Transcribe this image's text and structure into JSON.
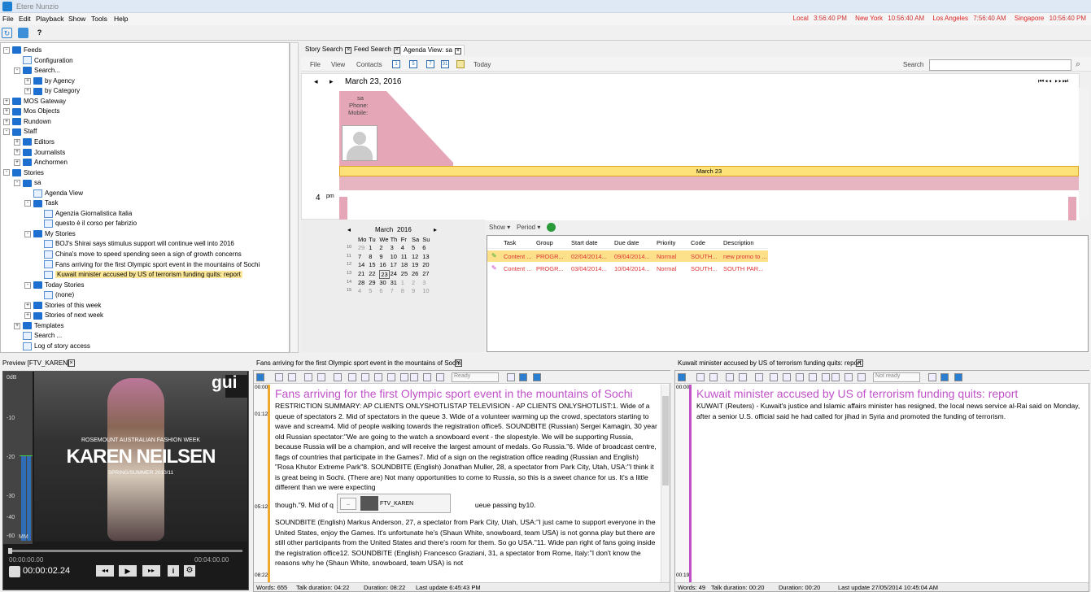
{
  "app": {
    "title": "Etere Nunzio"
  },
  "menu": [
    "File",
    "Edit",
    "Playback",
    "Show",
    "Tools",
    "Help"
  ],
  "clocks": [
    {
      "city": "Local",
      "time": "3:56:40 PM"
    },
    {
      "city": "New York",
      "time": "10:56:40 AM"
    },
    {
      "city": "Los Angeles",
      "time": "7:56:40 AM"
    },
    {
      "city": "Singapore",
      "time": "10:56:40 PM"
    }
  ],
  "tree": [
    {
      "label": "Feeds",
      "level": 0,
      "ex": "-"
    },
    {
      "label": "Configuration",
      "level": 1
    },
    {
      "label": "Search...",
      "level": 1,
      "ex": "-"
    },
    {
      "label": "by Agency",
      "level": 2,
      "ex": "+"
    },
    {
      "label": "by Category",
      "level": 2,
      "ex": "+"
    },
    {
      "label": "MOS Gateway",
      "level": 0,
      "ex": "+"
    },
    {
      "label": "Mos Objects",
      "level": 0,
      "ex": "+"
    },
    {
      "label": "Rundown",
      "level": 0,
      "ex": "+"
    },
    {
      "label": "Staff",
      "level": 0,
      "ex": "-"
    },
    {
      "label": "Editors",
      "level": 1,
      "ex": "+"
    },
    {
      "label": "Journalists",
      "level": 1,
      "ex": "+"
    },
    {
      "label": "Anchormen",
      "level": 1,
      "ex": "+"
    },
    {
      "label": "Stories",
      "level": 0,
      "ex": "-"
    },
    {
      "label": "sa",
      "level": 1,
      "ex": "-"
    },
    {
      "label": "Agenda View",
      "level": 2
    },
    {
      "label": "Task",
      "level": 2,
      "ex": "-"
    },
    {
      "label": "Agenzia Giornalistica Italia",
      "level": 3
    },
    {
      "label": "questo è il corso per fabrizio",
      "level": 3
    },
    {
      "label": "My Stories",
      "level": 2,
      "ex": "-"
    },
    {
      "label": "BOJ's Shirai says stimulus support will continue well into 2016",
      "level": 3
    },
    {
      "label": "China's move to speed spending seen a sign of growth concerns",
      "level": 3
    },
    {
      "label": "Fans arriving for the first Olympic sport event in the mountains of Sochi",
      "level": 3
    },
    {
      "label": "Kuwait minister accused by US of terrorism funding quits: report",
      "level": 3,
      "sel": true
    },
    {
      "label": "Today Stories",
      "level": 2,
      "ex": "-"
    },
    {
      "label": "(none)",
      "level": 3
    },
    {
      "label": "Stories of this week",
      "level": 2,
      "ex": "+"
    },
    {
      "label": "Stories of next week",
      "level": 2,
      "ex": "+"
    },
    {
      "label": "Templates",
      "level": 1,
      "ex": "+"
    },
    {
      "label": "Search ...",
      "level": 1
    },
    {
      "label": "Log of story access",
      "level": 1
    }
  ],
  "tabs": [
    "Story Search",
    "Feed Search",
    "Agenda View: sa"
  ],
  "agenda_toolbar": {
    "file": "File",
    "view": "View",
    "contacts": "Contacts",
    "today": "Today",
    "search_label": "Search",
    "cal_icons": [
      "1",
      "5",
      "7",
      "31"
    ]
  },
  "agenda": {
    "date": "March 23, 2016",
    "person": "sa",
    "phone": "Phone:",
    "mobile": "Mobile:",
    "day_label": "March 23",
    "hour": "4",
    "ampm": "pm"
  },
  "minical": {
    "month": "March",
    "year": "2016",
    "days": [
      "Mo",
      "Tu",
      "We",
      "Th",
      "Fr",
      "Sa",
      "Su"
    ],
    "weeks": [
      {
        "wk": "10",
        "d": [
          "29",
          "1",
          "2",
          "3",
          "4",
          "5",
          "6"
        ]
      },
      {
        "wk": "11",
        "d": [
          "7",
          "8",
          "9",
          "10",
          "11",
          "12",
          "13"
        ]
      },
      {
        "wk": "12",
        "d": [
          "14",
          "15",
          "16",
          "17",
          "18",
          "19",
          "20"
        ]
      },
      {
        "wk": "13",
        "d": [
          "21",
          "22",
          "23",
          "24",
          "25",
          "26",
          "27"
        ]
      },
      {
        "wk": "14",
        "d": [
          "28",
          "29",
          "30",
          "31",
          "1",
          "2",
          "3"
        ]
      },
      {
        "wk": "15",
        "d": [
          "4",
          "5",
          "6",
          "7",
          "8",
          "9",
          "10"
        ]
      }
    ]
  },
  "tasks": {
    "show": "Show",
    "period": "Period",
    "columns": [
      "Task",
      "Group",
      "Start date",
      "Due date",
      "Priority",
      "Code",
      "Description"
    ],
    "rows": [
      {
        "task": "Content ...",
        "group": "PROGR...",
        "start": "02/04/2014...",
        "due": "09/04/2014...",
        "priority": "Normal",
        "code": "SOUTH...",
        "desc": "new promo to ..."
      },
      {
        "task": "Content ...",
        "group": "PROGR...",
        "start": "03/04/2014...",
        "due": "10/04/2014...",
        "priority": "Normal",
        "code": "SOUTH...",
        "desc": "SOUTH PAR..."
      }
    ]
  },
  "preview": {
    "header": "Preview [FTV_KAREN]",
    "db": [
      "0dB",
      "-10",
      "-20",
      "-30",
      "-40",
      "-60"
    ],
    "mm": "MM",
    "event": "ROSEMOUNT AUSTRALIAN FASHION WEEK",
    "name": "KAREN NEILSEN",
    "season": "SPRING/SUMMER 2010/11",
    "logo": "gui",
    "tc_start": "00:00:00.00",
    "tc_end": "00:04:00.00",
    "tc_current": "00:00:02.24"
  },
  "editor1": {
    "header": "Fans arriving for the first Olympic sport event in the mountains of Sochi",
    "status_select": "Ready",
    "gutter": [
      "00:00",
      "01:12",
      "05:12",
      "08:22"
    ],
    "title": "Fans arriving for the first Olympic sport event in the mountains of Sochi",
    "p1": "RESTRICTION SUMMARY: AP CLIENTS ONLYSHOTLISTAP TELEVISION - AP CLIENTS ONLYSHOTLIST:1. Wide of a queue of spectators 2. Mid of spectators in the queue 3. Wide of a volunteer warming up the crowd, spectators starting to wave and scream4. Mid of people walking towards the registration office5. SOUNDBITE (Russian) Sergei Kamagin, 30 year old Russian spectator:\"We are going to the watch a snowboard event - the slopestyle. We will be supporting Russia, because Russia will be a champion, and will receive the largest amount of medals. Go Russia.\"6. Wide of broadcast centre, flags of countries that participate in the Games7. Mid of a sign on the registration office reading (Russian and English) \"Rosa Khutor Extreme Park\"8. SOUNDBITE (English) Jonathan Muller, 28, a spectator from Park City, Utah, USA:\"I think it is great being in Sochi. (There are) Not many opportunities to come to Russia, so this is a sweet chance for us. It's a little different than we were expecting",
    "p2a": "though.\"9. Mid of q",
    "p2b": "ueue passing by10.",
    "p3": "SOUNDBITE (English) Markus Anderson, 27, a spectator from Park City, Utah, USA:\"I just came to support everyone in the United States, enjoy the Games. It's unfortunate he's (Shaun White, snowboard, team USA) is not gonna play but there are still other participants from the United States and there's room for them. So go USA.\"11. Wide pan right of fans going inside the registration office12. SOUNDBITE (English) Francesco Graziani, 31, a spectator from Rome, Italy:\"I don't know the reasons why he (Shaun White, snowboard, team USA) is not",
    "popup_dots": "..",
    "popup_label": "FTV_KAREN",
    "status": {
      "words": "Words: 655",
      "talk": "Talk duration: 04:22",
      "duration": "Duration: 08:22",
      "update": "Last update 6:45:43 PM"
    }
  },
  "editor2": {
    "header": "Kuwait minister accused by US of terrorism funding quits: report",
    "status_select": "Not ready",
    "gutter": [
      "00:00",
      "00:19"
    ],
    "title": "Kuwait minister accused by US of terrorism funding quits: report",
    "p1": "KUWAIT (Reuters) - Kuwait's justice and Islamic affairs minister has resigned, the local news service al-Rai said on Monday, after a senior U.S. official said he had called for jihad in Syria and promoted the funding of terrorism.",
    "status": {
      "words": "Words: 49",
      "talk": "Talk duration: 00:20",
      "duration": "Duration: 00:20",
      "update": "Last update 27/05/2014 10:45:04 AM"
    }
  }
}
